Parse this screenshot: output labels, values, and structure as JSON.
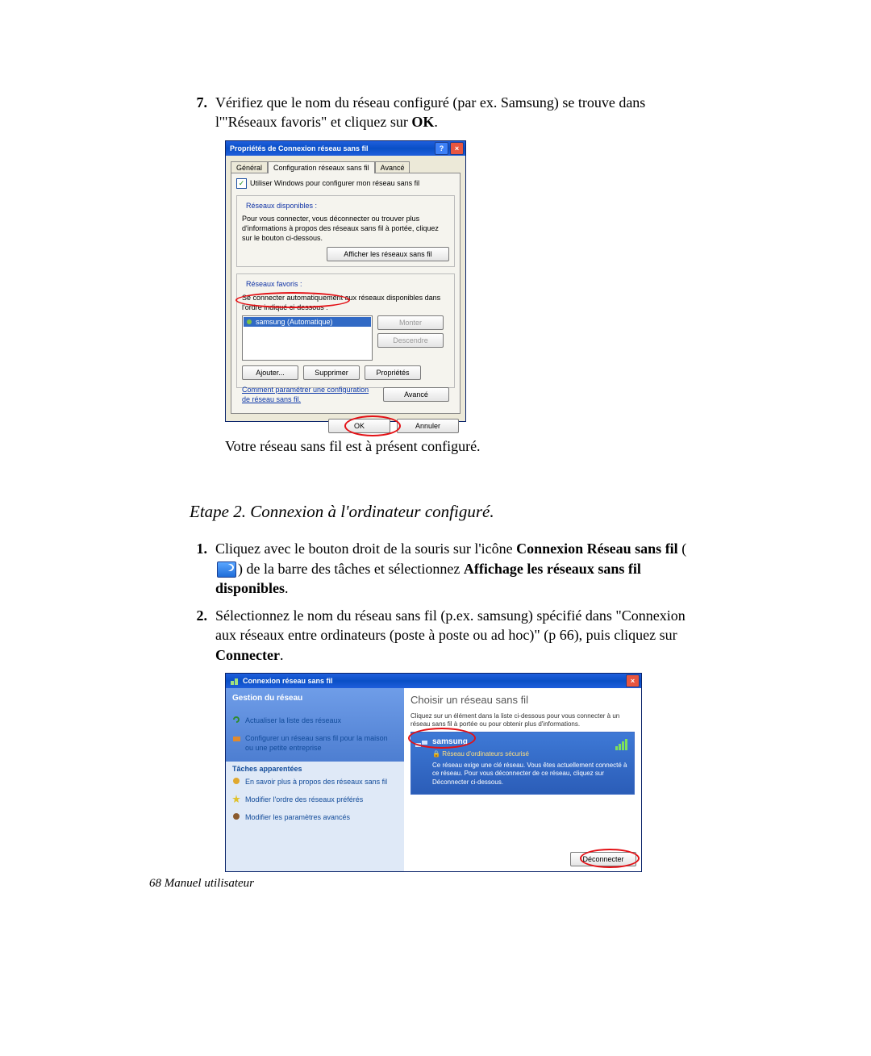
{
  "step7": {
    "num": "7.",
    "line1a": "Vérifiez que le nom du réseau configuré (par ex. Samsung) se trouve dans ",
    "line1b": "l'\"Réseaux favoris\"  et cliquez sur ",
    "ok": "OK",
    "dot": "."
  },
  "dlg1": {
    "title": "Propriétés de Connexion réseau sans fil",
    "help": "?",
    "close": "×",
    "tabs": {
      "general": "Général",
      "config": "Configuration réseaux sans fil",
      "advanced": "Avancé"
    },
    "useWindows": "Utiliser Windows pour configurer mon réseau sans fil",
    "grp1Title": "Réseaux disponibles :",
    "grp1Text": "Pour vous connecter, vous déconnecter ou trouver plus d'informations à propos des réseaux sans fil à portée, cliquez sur le bouton ci-dessous.",
    "grp1Btn": "Afficher les réseaux sans fil",
    "grp2Title": "Réseaux favoris :",
    "grp2Text": "Se connecter automatiquement aux réseaux disponibles dans l'ordre indiqué ci-dessous :",
    "listItem": "samsung (Automatique)",
    "btnUp": "Monter",
    "btnDown": "Descendre",
    "btnAdd": "Ajouter...",
    "btnDel": "Supprimer",
    "btnProp": "Propriétés",
    "linkText": "Comment paramétrer une configuration de réseau sans fil.",
    "btnAdv": "Avancé",
    "btnOk": "OK",
    "btnCancel": "Annuler"
  },
  "afterDlg1": "Votre réseau sans fil est à présent configuré.",
  "stepTitle": "Etape 2. Connexion à l'ordinateur configuré.",
  "step1": {
    "num": "1.",
    "a": "Cliquez avec le bouton droit de la souris sur l'icône ",
    "b": "Connexion Réseau sans fil",
    "c": " (",
    "d": ") de la barre des tâches et sélectionnez ",
    "e": "Affichage les réseaux sans fil disponibles",
    "f": "."
  },
  "step2": {
    "num": "2.",
    "a": "Sélectionnez le nom du réseau sans fil (p.ex. samsung) spécifié dans  \"Connexion aux réseaux entre ordinateurs (poste à poste ou ad hoc)\" (p 66), puis cliquez sur ",
    "b": "Connecter",
    "c": "."
  },
  "dlg2": {
    "title": "Connexion réseau sans fil",
    "close": "×",
    "leftHead": "Gestion du réseau",
    "l1": "Actualiser la liste des réseaux",
    "l2": "Configurer un réseau sans fil pour la maison ou une petite entreprise",
    "leftSub": "Tâches apparentées",
    "l3": "En savoir plus à propos des réseaux sans fil",
    "l4": "Modifier l'ordre des réseaux préférés",
    "l5": "Modifier les paramètres avancés",
    "rTitle": "Choisir un réseau sans fil",
    "rHint1": "Cliquez sur un élément dans la liste ci-dessous pour vous connecter à un réseau sans fil à portée ou pour obtenir plus d'informations.",
    "ssid": "samsung",
    "sec": "Réseau d'ordinateurs sécurisé",
    "desc": "Ce réseau exige une clé réseau. Vous êtes actuellement connecté à ce réseau. Pour vous déconnecter de ce réseau, cliquez sur Déconnecter ci-dessous.",
    "btn": "Déconnecter"
  },
  "footer": "68  Manuel utilisateur"
}
